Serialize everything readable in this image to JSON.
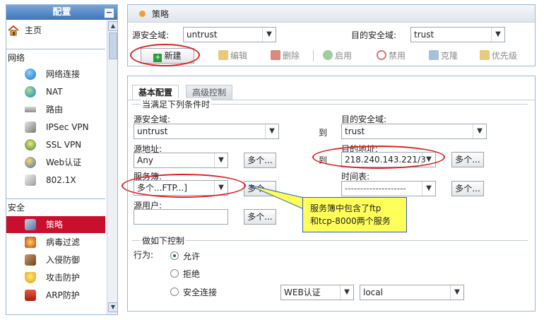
{
  "sidebar": {
    "title": "配置",
    "collapse": "−",
    "home": "主页",
    "sections": [
      {
        "title": "网络",
        "items": [
          {
            "label": "网络连接",
            "icon": "globe-icon"
          },
          {
            "label": "NAT",
            "icon": "nat-globe-icon"
          },
          {
            "label": "路由",
            "icon": "router-icon"
          },
          {
            "label": "IPSec VPN",
            "icon": "ipsec-vpn-icon"
          },
          {
            "label": "SSL VPN",
            "icon": "ssl-vpn-icon"
          },
          {
            "label": "Web认证",
            "icon": "web-auth-icon"
          },
          {
            "label": "802.1X",
            "icon": "dot1x-icon"
          }
        ]
      },
      {
        "title": "安全",
        "items": [
          {
            "label": "策略",
            "icon": "policy-icon",
            "selected": true
          },
          {
            "label": "病毒过滤",
            "icon": "virus-filter-icon"
          },
          {
            "label": "入侵防御",
            "icon": "intrusion-prevention-icon"
          },
          {
            "label": "攻击防护",
            "icon": "attack-protection-icon"
          },
          {
            "label": "ARP防护",
            "icon": "arp-protection-icon"
          }
        ]
      }
    ]
  },
  "top": {
    "title": "策略",
    "src_zone_label": "源安全域:",
    "src_zone_value": "untrust",
    "dst_zone_label": "目的安全域:",
    "dst_zone_value": "trust",
    "toolbar": {
      "new": "新建",
      "edit": "编辑",
      "delete": "删除",
      "enable": "启用",
      "disable": "禁用",
      "clone": "克隆",
      "priority": "优先级"
    }
  },
  "form": {
    "tabs": [
      "基本配置",
      "高级控制"
    ],
    "group_conditions": "当满足下列条件时",
    "src_zone_label": "源安全域:",
    "src_zone_value": "untrust",
    "to_label": "到",
    "dst_zone_label": "目的安全域:",
    "dst_zone_value": "trust",
    "src_addr_label": "源地址:",
    "src_addr_value": "Any",
    "dst_addr_label": "目的地址:",
    "dst_addr_value": "218.240.143.221/3",
    "service_label": "服务簿:",
    "service_value": "多个...FTP...]",
    "schedule_label": "时间表:",
    "schedule_value": "--------------------",
    "src_user_label": "源用户:",
    "more_label": "多个...",
    "group_action": "做如下控制",
    "action_label": "行为:",
    "action_options": [
      "允许",
      "拒绝",
      "安全连接"
    ],
    "auth_type_value": "WEB认证",
    "auth_server_value": "local"
  },
  "callout": {
    "text_line1": "服务簿中包含了ftp",
    "text_line2": "和tcp-8000两个服务"
  },
  "colors": {
    "highlight_red": "#d92323",
    "callout_yellow": "#ffff5a",
    "sidebar_selected": "#c8102e"
  }
}
